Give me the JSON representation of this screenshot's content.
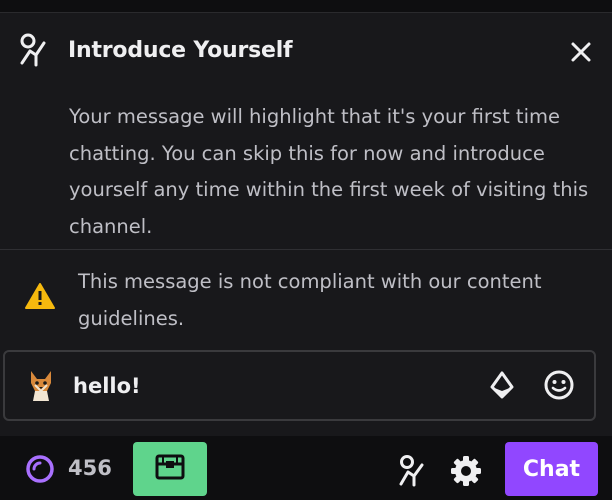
{
  "intro": {
    "title": "Introduce Yourself",
    "body": "Your message will highlight that it's your first time chatting. You can skip this for now and introduce yourself any time within the first week of visiting this channel."
  },
  "warning": {
    "text": "This message is not compliant with our content guidelines."
  },
  "chat_input": {
    "value": "hello!"
  },
  "bottom_bar": {
    "points": "456",
    "chat_button_label": "Chat"
  },
  "colors": {
    "accent": "#9147ff",
    "bonus": "#5fd48c",
    "warning": "#f6b90e"
  },
  "icons": [
    "introduce-yourself-icon",
    "close-icon",
    "warning-icon",
    "user-avatar",
    "bits-icon",
    "emote-icon",
    "channel-points-icon",
    "bonus-chest-icon",
    "settings-icon"
  ]
}
